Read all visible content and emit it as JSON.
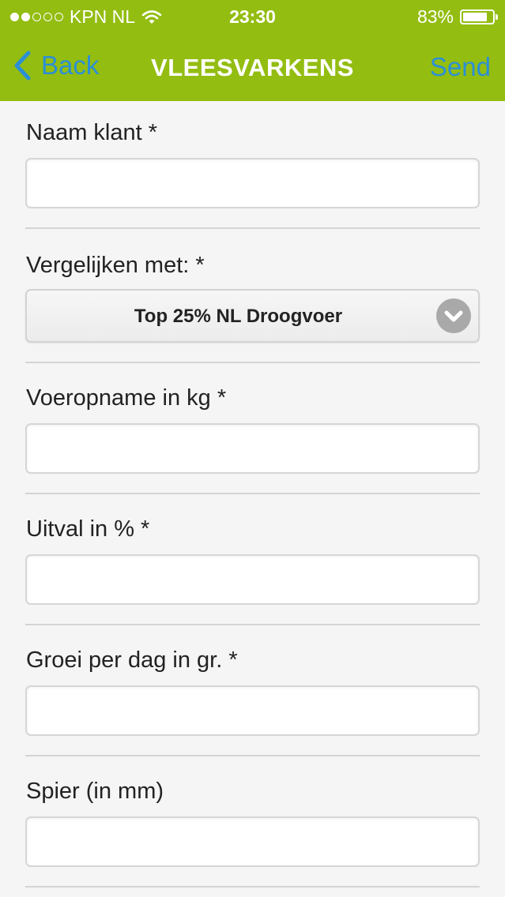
{
  "status_bar": {
    "carrier": "KPN NL",
    "time": "23:30",
    "battery": "83%",
    "battery_level": 0.83,
    "signal_bars": 2
  },
  "nav": {
    "back_label": "Back",
    "title": "VLEESVARKENS",
    "send_label": "Send"
  },
  "form": {
    "naam_klant": {
      "label": "Naam klant *",
      "value": ""
    },
    "vergelijken": {
      "label": "Vergelijken met: *",
      "selected": "Top 25% NL Droogvoer"
    },
    "voeropname": {
      "label": "Voeropname in kg *",
      "value": ""
    },
    "uitval": {
      "label": "Uitval in % *",
      "value": ""
    },
    "groei": {
      "label": "Groei per dag in gr. *",
      "value": ""
    },
    "spier": {
      "label": "Spier (in mm)",
      "value": ""
    }
  },
  "colors": {
    "header_bg": "#93bd11",
    "nav_link": "#2b8fd6",
    "page_bg": "#f5f5f5"
  }
}
